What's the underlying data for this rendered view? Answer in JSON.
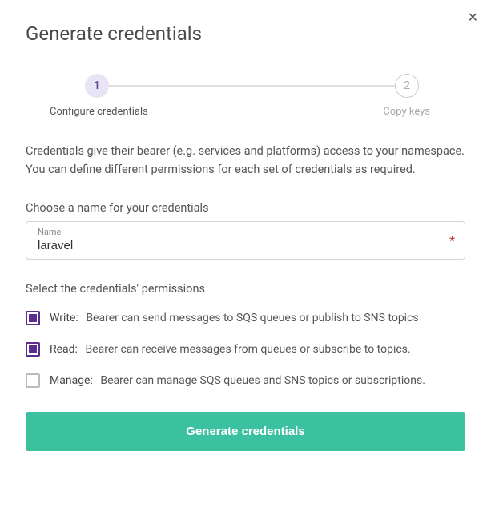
{
  "modal": {
    "title": "Generate credentials",
    "close_icon": "✕"
  },
  "stepper": {
    "step1": {
      "number": "1",
      "label": "Configure credentials"
    },
    "step2": {
      "number": "2",
      "label": "Copy keys"
    }
  },
  "description": "Credentials give their bearer (e.g. services and platforms) access to your namespace. You can define different permissions for each set of credentials as required.",
  "name_field": {
    "section_label": "Choose a name for your credentials",
    "floating_label": "Name",
    "value": "laravel",
    "required_mark": "*"
  },
  "permissions": {
    "section_label": "Select the credentials' permissions",
    "items": [
      {
        "name": "Write:",
        "desc": "Bearer can send messages to SQS queues or publish to SNS topics",
        "checked": true
      },
      {
        "name": "Read:",
        "desc": "Bearer can receive messages from queues or subscribe to topics.",
        "checked": true
      },
      {
        "name": "Manage:",
        "desc": "Bearer can manage SQS queues and SNS topics or subscriptions.",
        "checked": false
      }
    ]
  },
  "submit": {
    "label": "Generate credentials"
  }
}
